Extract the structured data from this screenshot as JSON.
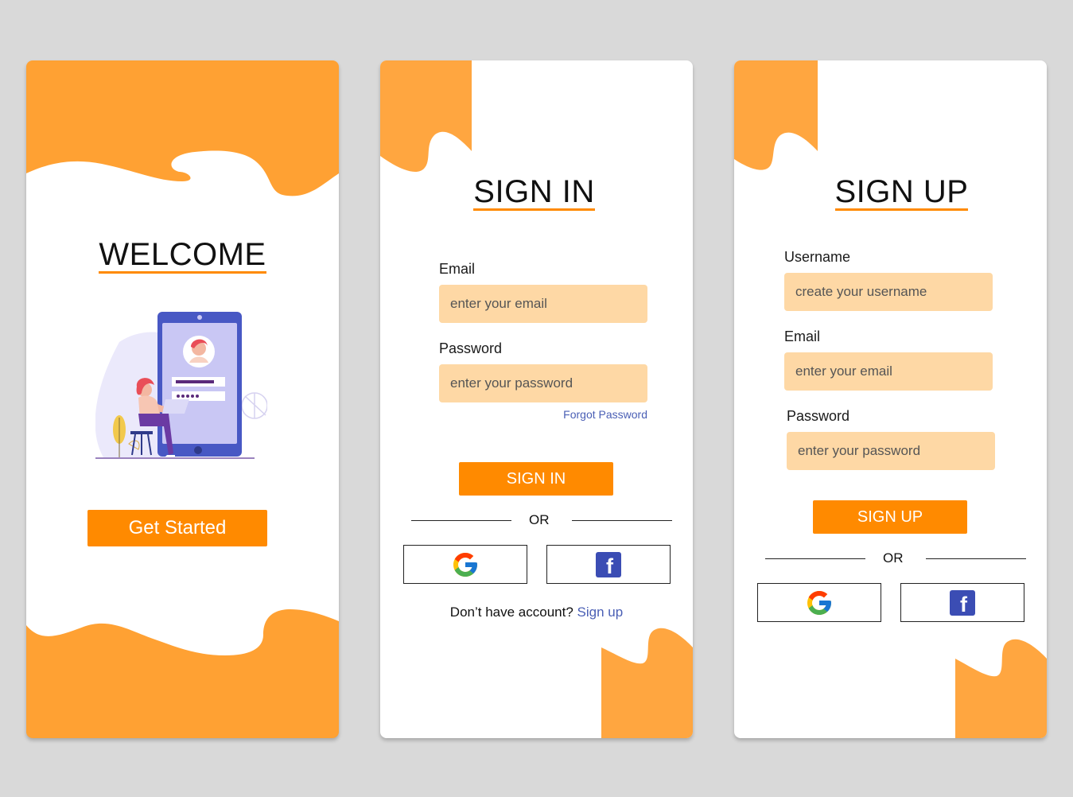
{
  "welcome": {
    "title": "WELCOME",
    "button": "Get Started"
  },
  "signin": {
    "title": "SIGN IN",
    "email_label": "Email",
    "email_placeholder": "enter your email",
    "password_label": "Password",
    "password_placeholder": "enter your password",
    "forgot": "Forgot Password",
    "button": "SIGN IN",
    "or": "OR",
    "no_account": "Don’t have account?",
    "signup_link": "Sign up"
  },
  "signup": {
    "title": "SIGN UP",
    "username_label": "Username",
    "username_placeholder": "create your username",
    "email_label": "Email",
    "email_placeholder": "enter your email",
    "password_label": "Password",
    "password_placeholder": "enter your password",
    "button": "SIGN UP",
    "or": "OR"
  },
  "icons": {
    "facebook_glyph": "f"
  },
  "colors": {
    "accent": "#ff8a00",
    "wave": "#ffa133",
    "input_bg": "#fed8a5",
    "link": "#4a5fb5"
  }
}
